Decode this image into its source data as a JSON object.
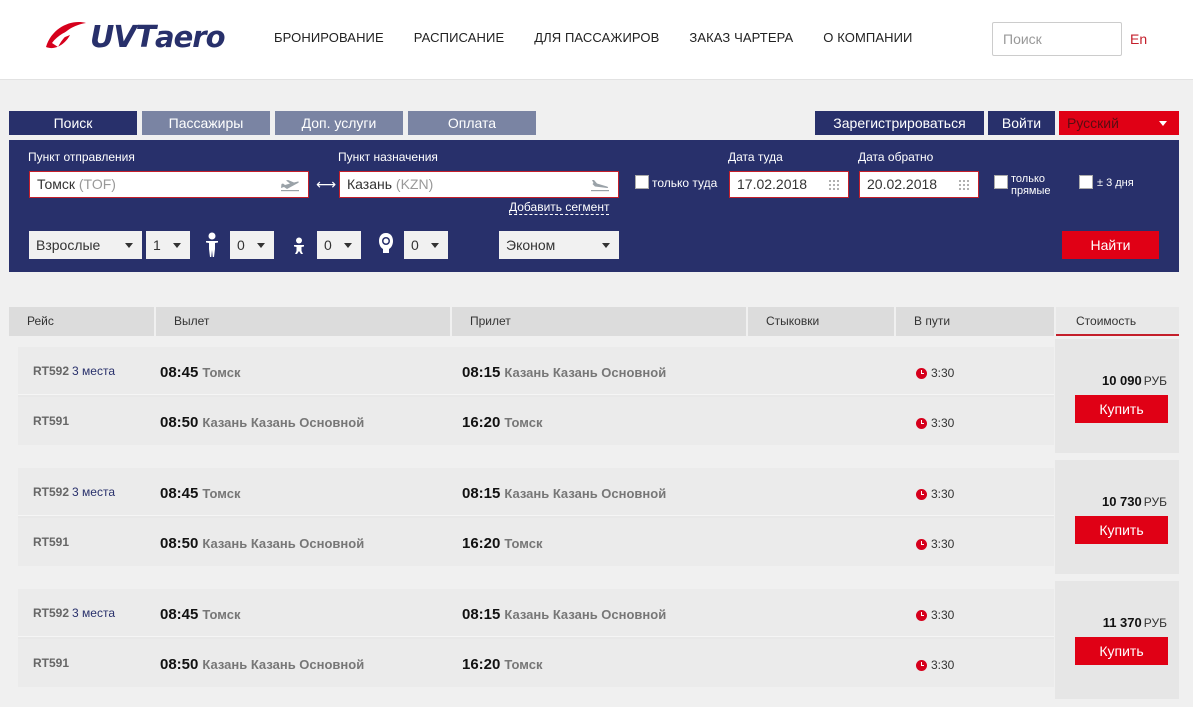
{
  "header": {
    "logo_uvt": "UVT",
    "logo_aero": "aero",
    "nav": [
      "БРОНИРОВАНИЕ",
      "РАСПИСАНИЕ",
      "ДЛЯ ПАССАЖИРОВ",
      "ЗАКАЗ ЧАРТЕРА",
      "О КОМПАНИИ"
    ],
    "search_placeholder": "Поиск",
    "lang_en": "En"
  },
  "tabs": [
    {
      "label": "Поиск",
      "active": true
    },
    {
      "label": "Пассажиры",
      "active": false
    },
    {
      "label": "Доп. услуги",
      "active": false
    },
    {
      "label": "Оплата",
      "active": false
    }
  ],
  "account": {
    "register": "Зарегистрироваться",
    "login": "Войти",
    "language": "Русский"
  },
  "search_form": {
    "from_label": "Пункт отправления",
    "from_city": "Томск",
    "from_code": "(TOF)",
    "to_label": "Пункт назначения",
    "to_city": "Казань",
    "to_code": "(KZN)",
    "add_segment": "Добавить сегмент",
    "one_way": "только туда",
    "date_there_label": "Дата туда",
    "date_there": "17.02.2018",
    "date_back_label": "Дата обратно",
    "date_back": "20.02.2018",
    "direct_only_1": "только",
    "direct_only_2": "прямые",
    "plus_minus_3": "± 3 дня",
    "pax_type": "Взрослые",
    "adults": "1",
    "children": "0",
    "kids": "0",
    "infants": "0",
    "cabin": "Эконом",
    "find": "Найти"
  },
  "results_header": {
    "flight": "Рейс",
    "departure": "Вылет",
    "arrival": "Прилет",
    "connections": "Стыковки",
    "in_flight": "В пути",
    "price": "Стоимость"
  },
  "results": [
    {
      "price": "10 090",
      "currency": "РУБ",
      "buy": "Купить",
      "legs": [
        {
          "flight": "RT592",
          "seats": "3 места",
          "dep_time": "08:45",
          "dep_city": "Томск",
          "arr_time": "08:15",
          "arr_city": "Казань Казань Основной",
          "duration": "3:30"
        },
        {
          "flight": "RT591",
          "seats": "",
          "dep_time": "08:50",
          "dep_city": "Казань Казань Основной",
          "arr_time": "16:20",
          "arr_city": "Томск",
          "duration": "3:30"
        }
      ]
    },
    {
      "price": "10 730",
      "currency": "РУБ",
      "buy": "Купить",
      "legs": [
        {
          "flight": "RT592",
          "seats": "3 места",
          "dep_time": "08:45",
          "dep_city": "Томск",
          "arr_time": "08:15",
          "arr_city": "Казань Казань Основной",
          "duration": "3:30"
        },
        {
          "flight": "RT591",
          "seats": "",
          "dep_time": "08:50",
          "dep_city": "Казань Казань Основной",
          "arr_time": "16:20",
          "arr_city": "Томск",
          "duration": "3:30"
        }
      ]
    },
    {
      "price": "11 370",
      "currency": "РУБ",
      "buy": "Купить",
      "legs": [
        {
          "flight": "RT592",
          "seats": "3 места",
          "dep_time": "08:45",
          "dep_city": "Томск",
          "arr_time": "08:15",
          "arr_city": "Казань Казань Основной",
          "duration": "3:30"
        },
        {
          "flight": "RT591",
          "seats": "",
          "dep_time": "08:50",
          "dep_city": "Казань Казань Основной",
          "arr_time": "16:20",
          "arr_city": "Томск",
          "duration": "3:30"
        }
      ]
    }
  ],
  "colors": {
    "brand_navy": "#28306b",
    "accent_red": "#e00015",
    "tab_inactive": "#7a84a3"
  }
}
